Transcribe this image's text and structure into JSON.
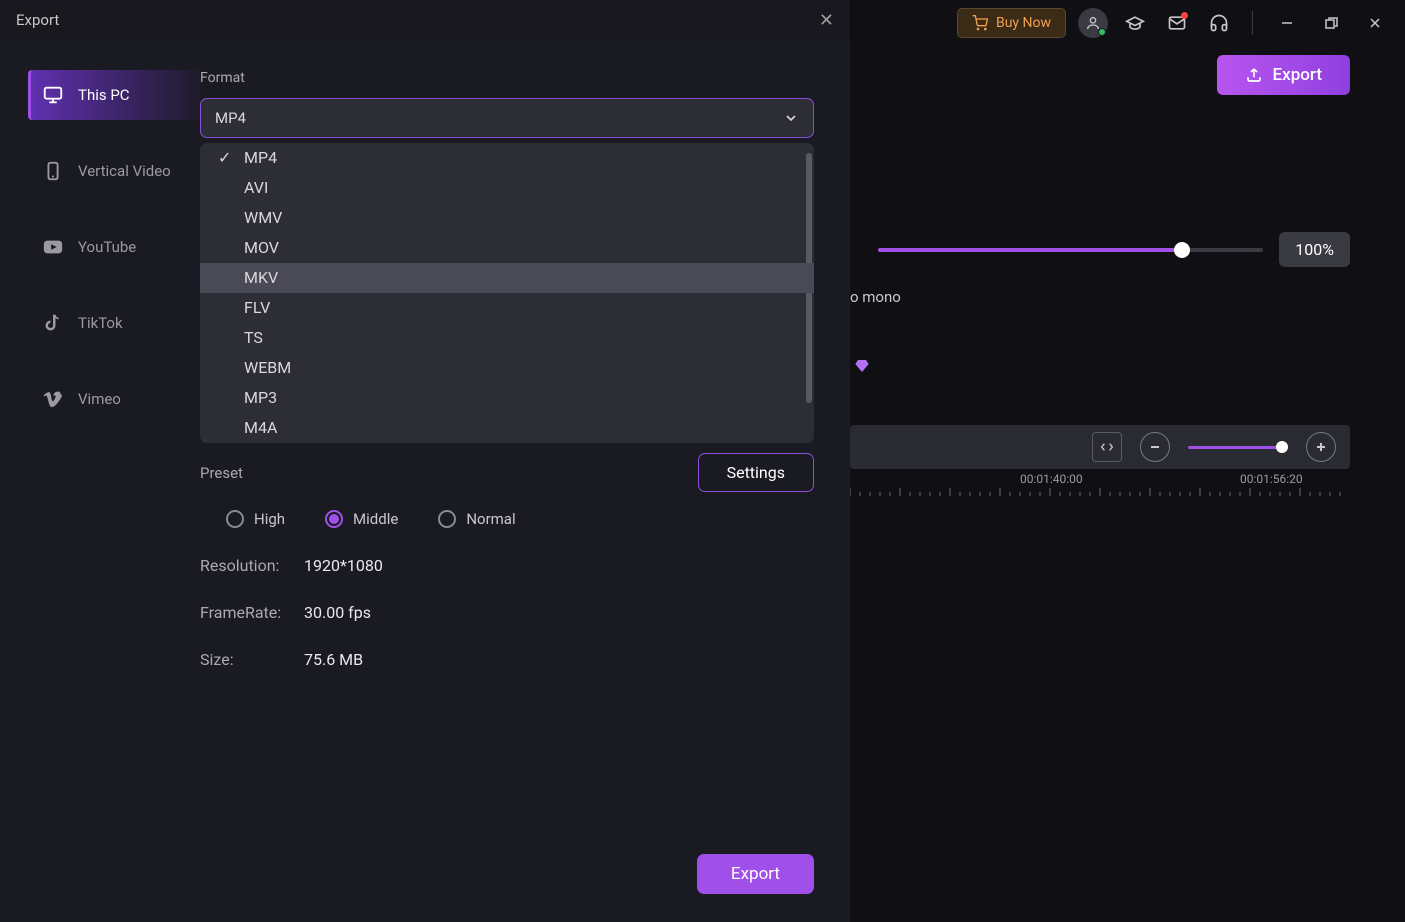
{
  "toolbar": {
    "buy_now": "Buy Now"
  },
  "export_top_label": "Export",
  "quality_percent": "100%",
  "mono_text": "o mono",
  "timeline": {
    "t1": "00:01:40:00",
    "t2": "00:01:56:20"
  },
  "modal": {
    "title": "Export",
    "sidebar": [
      {
        "id": "this-pc",
        "label": "This PC",
        "icon": "monitor"
      },
      {
        "id": "vertical-video",
        "label": "Vertical Video",
        "icon": "phone"
      },
      {
        "id": "youtube",
        "label": "YouTube",
        "icon": "youtube"
      },
      {
        "id": "tiktok",
        "label": "TikTok",
        "icon": "tiktok"
      },
      {
        "id": "vimeo",
        "label": "Vimeo",
        "icon": "vimeo"
      }
    ],
    "format_label": "Format",
    "format_selected": "MP4",
    "format_options": [
      "MP4",
      "AVI",
      "WMV",
      "MOV",
      "MKV",
      "FLV",
      "TS",
      "WEBM",
      "MP3",
      "M4A"
    ],
    "format_hover": "MKV",
    "preset_label": "Preset",
    "preset_options": [
      "High",
      "Middle",
      "Normal"
    ],
    "preset_selected": "Middle",
    "settings_label": "Settings",
    "info": {
      "resolution_label": "Resolution:",
      "resolution_value": "1920*1080",
      "framerate_label": "FrameRate:",
      "framerate_value": "30.00 fps",
      "size_label": "Size:",
      "size_value": "75.6 MB"
    },
    "export_button": "Export"
  }
}
